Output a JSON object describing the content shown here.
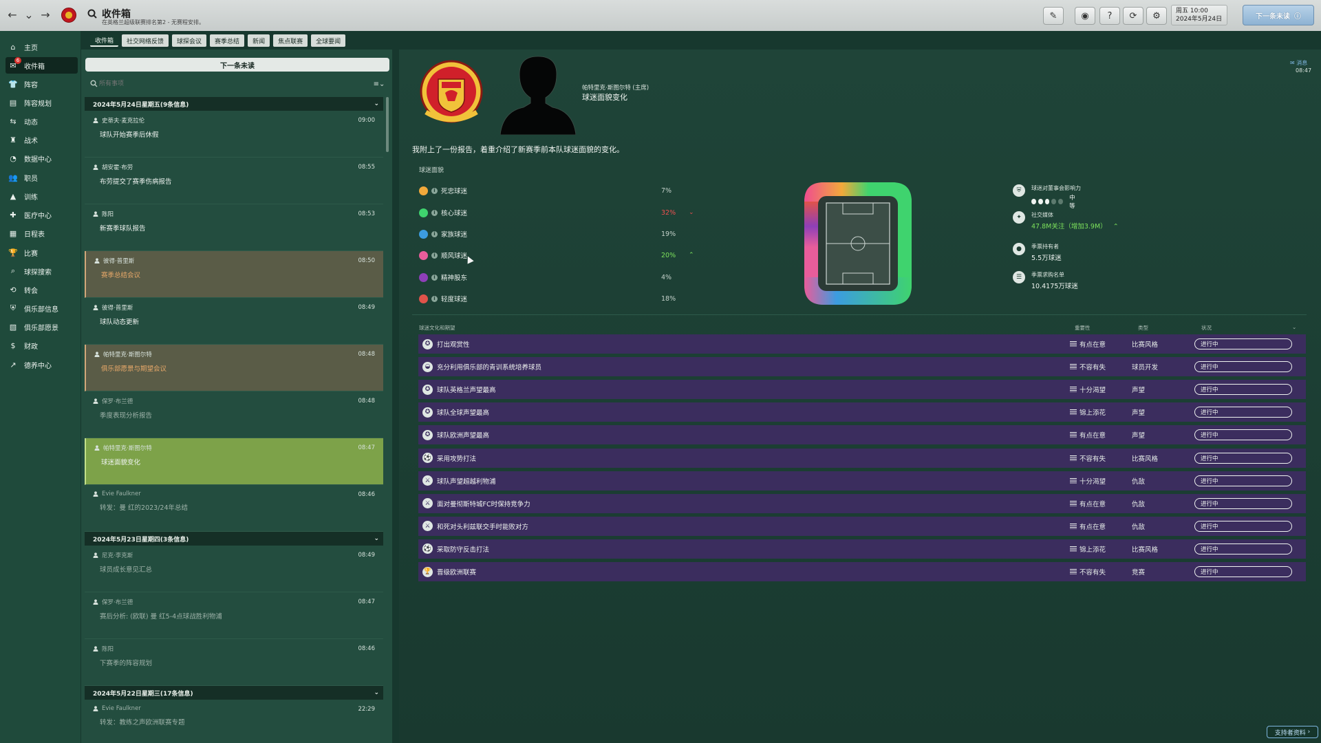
{
  "topbar": {
    "title": "收件箱",
    "subtitle": "在英格兰超级联赛排名第2 - 无赛程安排。",
    "date_line1": "周五 10:00",
    "date_line2": "2024年5月24日",
    "continue_label": "下一条未读"
  },
  "sidebar": {
    "badge": "6",
    "items": [
      {
        "label": "主页",
        "icon": "home-icon"
      },
      {
        "label": "收件箱",
        "icon": "inbox-icon"
      },
      {
        "label": "阵容",
        "icon": "squad-icon"
      },
      {
        "label": "阵容规划",
        "icon": "squad-planner-icon"
      },
      {
        "label": "动态",
        "icon": "dynamics-icon"
      },
      {
        "label": "战术",
        "icon": "tactics-icon"
      },
      {
        "label": "数据中心",
        "icon": "data-hub-icon"
      },
      {
        "label": "职员",
        "icon": "staff-icon"
      },
      {
        "label": "训练",
        "icon": "training-icon"
      },
      {
        "label": "医疗中心",
        "icon": "medical-icon"
      },
      {
        "label": "日程表",
        "icon": "calendar-icon"
      },
      {
        "label": "比赛",
        "icon": "trophy-icon"
      },
      {
        "label": "球探搜索",
        "icon": "scouting-icon"
      },
      {
        "label": "转会",
        "icon": "transfers-icon"
      },
      {
        "label": "俱乐部信息",
        "icon": "club-info-icon"
      },
      {
        "label": "俱乐部愿景",
        "icon": "club-vision-icon"
      },
      {
        "label": "财政",
        "icon": "finances-icon"
      },
      {
        "label": "德养中心",
        "icon": "development-icon"
      }
    ]
  },
  "tabs": [
    "收件箱",
    "社交网络反馈",
    "球探会议",
    "赛季总结",
    "新闻",
    "焦点联赛",
    "全球要闻"
  ],
  "inbox": {
    "next_unread_label": "下一条未读",
    "filter_placeholder": "所有事项",
    "days": [
      {
        "header": "2024年5月24日星期五(9条信息)",
        "messages": [
          {
            "sender": "史蒂夫·麦克拉伦",
            "time": "09:00",
            "subject": "球队开始赛季后休假",
            "style": "normal"
          },
          {
            "sender": "胡安霍·布劳",
            "time": "08:55",
            "subject": "布劳提交了赛季伤病报告",
            "style": "normal"
          },
          {
            "sender": "陈阳",
            "time": "08:53",
            "subject": "新赛季球队报告",
            "style": "normal"
          },
          {
            "sender": "彼得·普里斯",
            "time": "08:50",
            "subject": "赛季总结会议",
            "style": "hl"
          },
          {
            "sender": "彼得·普里斯",
            "time": "08:49",
            "subject": "球队动态更新",
            "style": "normal"
          },
          {
            "sender": "帕特里克·斯图尔特",
            "time": "08:48",
            "subject": "俱乐部愿景与期望会议",
            "style": "hl"
          },
          {
            "sender": "保罗·布兰德",
            "time": "08:48",
            "subject": "季度表现分析报告",
            "style": "read"
          },
          {
            "sender": "帕特里克·斯图尔特",
            "time": "08:47",
            "subject": "球迷面貌变化",
            "style": "sel"
          },
          {
            "sender": "Evie Faulkner",
            "time": "08:46",
            "subject": "转发：曼 红的2023/24年总结",
            "style": "read"
          }
        ]
      },
      {
        "header": "2024年5月23日星期四(3条信息)",
        "messages": [
          {
            "sender": "尼克·李克斯",
            "time": "08:49",
            "subject": "球员成长意见汇总",
            "style": "read"
          },
          {
            "sender": "保罗·布兰德",
            "time": "08:47",
            "subject": "赛后分析: (欧联) 曼 红5-4点球战胜利物浦",
            "style": "read"
          },
          {
            "sender": "陈阳",
            "time": "08:46",
            "subject": "下赛季的阵容规划",
            "style": "read"
          }
        ]
      },
      {
        "header": "2024年5月22日星期三(17条信息)",
        "messages": [
          {
            "sender": "Evie Faulkner",
            "time": "22:29",
            "subject": "转发：教练之声欧洲联赛专题",
            "style": "read"
          }
        ]
      }
    ]
  },
  "message": {
    "sender": "帕特里克·斯图尔特 (主席)",
    "subject": "球迷面貌变化",
    "chip": "消息",
    "time": "08:47",
    "intro": "我附上了一份报告，着重介绍了新赛季前本队球迷面貌的变化。",
    "fan_section_title": "球迷面貌",
    "fan_groups": [
      {
        "label": "死忠球迷",
        "pct": "7%",
        "color": "#f2a93b",
        "trend": ""
      },
      {
        "label": "核心球迷",
        "pct": "32%",
        "color": "#3fd36e",
        "trend": "down"
      },
      {
        "label": "家族球迷",
        "pct": "19%",
        "color": "#3c9ce0",
        "trend": ""
      },
      {
        "label": "顺风球迷",
        "pct": "20%",
        "color": "#e85d9b",
        "trend": "up"
      },
      {
        "label": "精神股东",
        "pct": "4%",
        "color": "#8e3fb8",
        "trend": ""
      },
      {
        "label": "轻度球迷",
        "pct": "18%",
        "color": "#e0534a",
        "trend": ""
      }
    ],
    "stats": {
      "influence_label": "球迷对董事会影响力",
      "influence_value": "中等",
      "influence_level": 3,
      "influence_max": 5,
      "social_label": "社交媒体",
      "social_value": "47.8M关注（增加3.9M）",
      "season_ticket_label": "季票持有者",
      "season_ticket_value": "5.5万球迷",
      "waitlist_label": "季票求购名单",
      "waitlist_value": "10.4175万球迷"
    },
    "culture_title": "球迷文化和期望",
    "culture_cols": {
      "importance": "重要性",
      "type": "类型",
      "status": "状况"
    },
    "culture_rows": [
      {
        "name": "打出观赏性",
        "importance": "有点在意",
        "type": "比赛风格",
        "status": "进行中",
        "icon": "star-icon"
      },
      {
        "name": "充分利用俱乐部的青训系统培养球员",
        "importance": "不容有失",
        "type": "球员开发",
        "status": "进行中",
        "icon": "youth-icon"
      },
      {
        "name": "球队英格兰声望最高",
        "importance": "十分渴望",
        "type": "声望",
        "status": "进行中",
        "icon": "star-icon"
      },
      {
        "name": "球队全球声望最高",
        "importance": "锦上添花",
        "type": "声望",
        "status": "进行中",
        "icon": "star-icon"
      },
      {
        "name": "球队欧洲声望最高",
        "importance": "有点在意",
        "type": "声望",
        "status": "进行中",
        "icon": "star-icon"
      },
      {
        "name": "采用攻势打法",
        "importance": "不容有失",
        "type": "比赛风格",
        "status": "进行中",
        "icon": "ball-icon"
      },
      {
        "name": "球队声望超越利物浦",
        "importance": "十分渴望",
        "type": "仇敌",
        "status": "进行中",
        "icon": "rival-icon"
      },
      {
        "name": "面对曼彻斯特城FC时保持竞争力",
        "importance": "有点在意",
        "type": "仇敌",
        "status": "进行中",
        "icon": "rival-icon"
      },
      {
        "name": "和死对头利兹联交手时能败对方",
        "importance": "有点在意",
        "type": "仇敌",
        "status": "进行中",
        "icon": "rival-icon"
      },
      {
        "name": "采取防守反击打法",
        "importance": "锦上添花",
        "type": "比赛风格",
        "status": "进行中",
        "icon": "ball-icon"
      },
      {
        "name": "晋级欧洲联赛",
        "importance": "不容有失",
        "type": "竞赛",
        "status": "进行中",
        "icon": "cup-icon"
      }
    ],
    "supporter_btn": "支持者资料"
  },
  "colors": {
    "selected_msg": "#7da249",
    "highlight_msg": "#5a5c47",
    "culture_row": "#3b2d5e",
    "accent_blue": "#7fb6e0"
  }
}
